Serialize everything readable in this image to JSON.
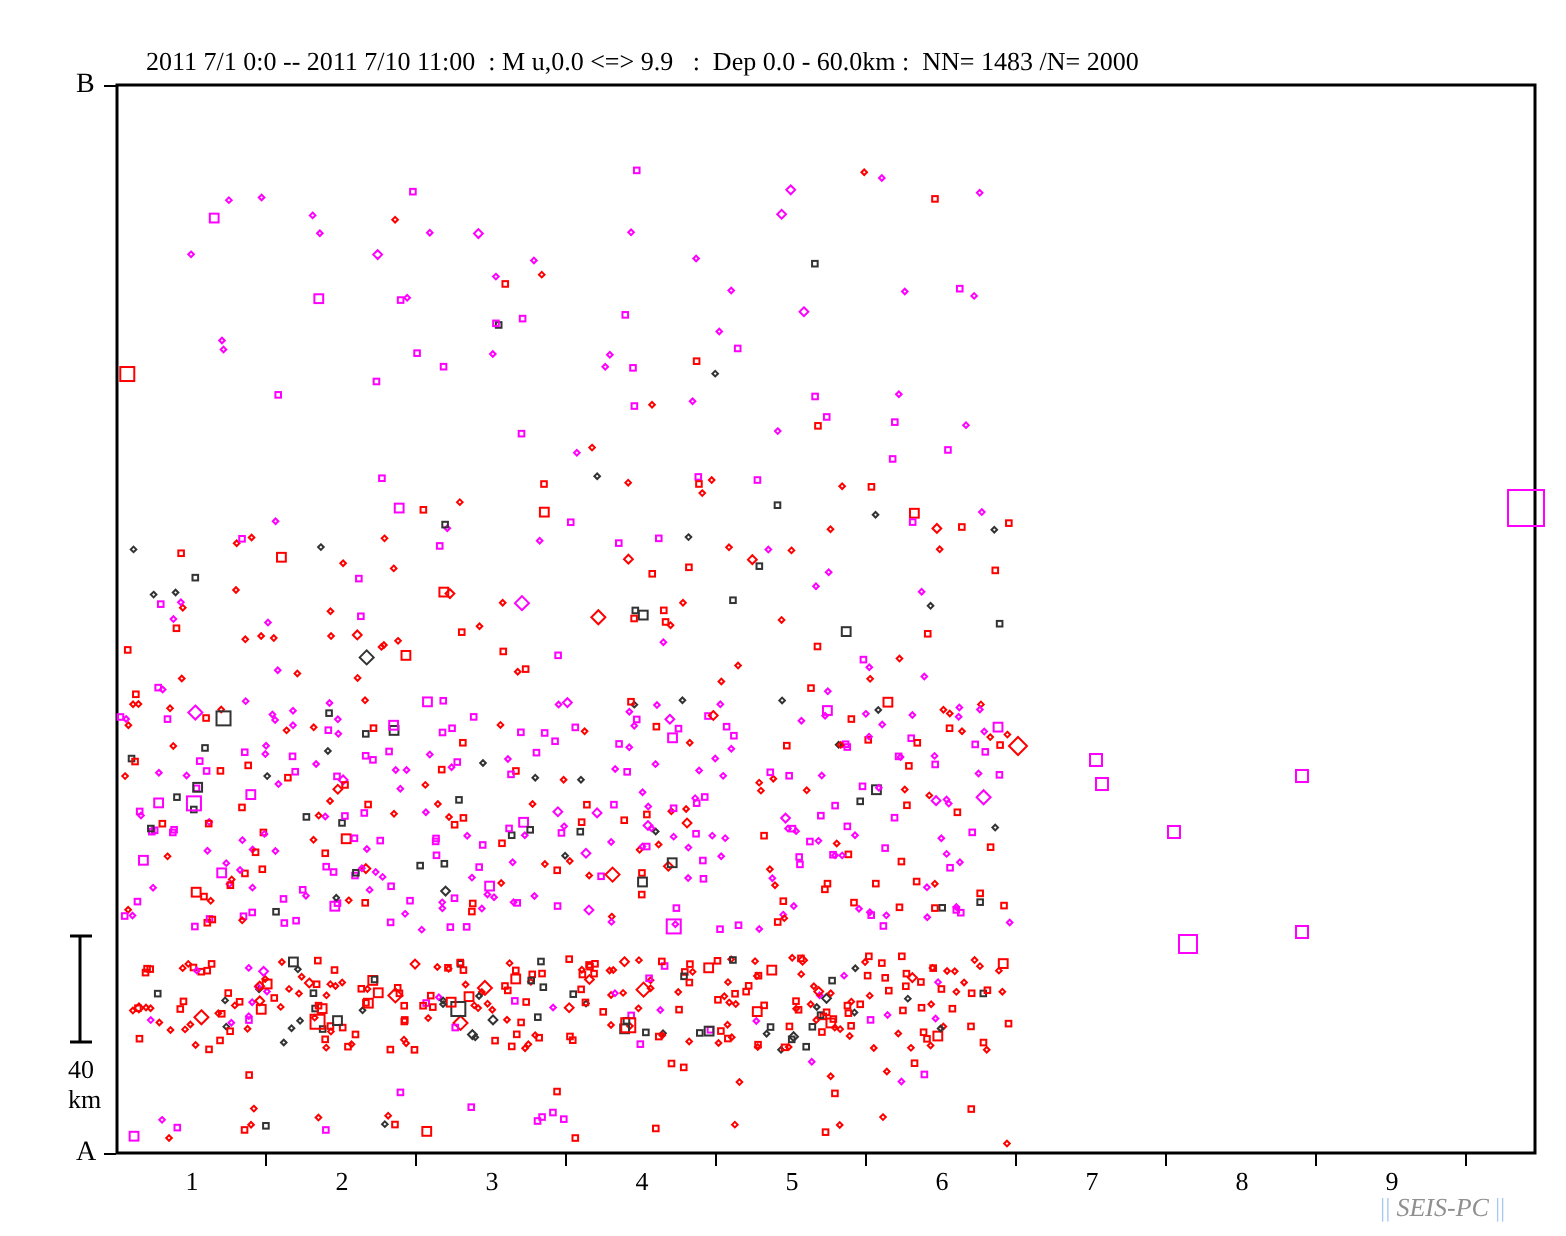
{
  "title": "2011 7/1 0:0 -- 2011 7/10 11:00  : M u,0.0 <=> 9.9   :  Dep 0.0 - 60.0km :  NN= 1483 /N= 2000",
  "plot": {
    "top_label": "B",
    "bottom_label": "A",
    "scale_value": "40",
    "scale_unit": "km",
    "x_labels": [
      "1",
      "2",
      "3",
      "4",
      "5",
      "6",
      "7",
      "8",
      "9"
    ]
  },
  "footer": {
    "left_bars": "||",
    "text": "SEIS-PC",
    "right_bars": "||"
  }
}
